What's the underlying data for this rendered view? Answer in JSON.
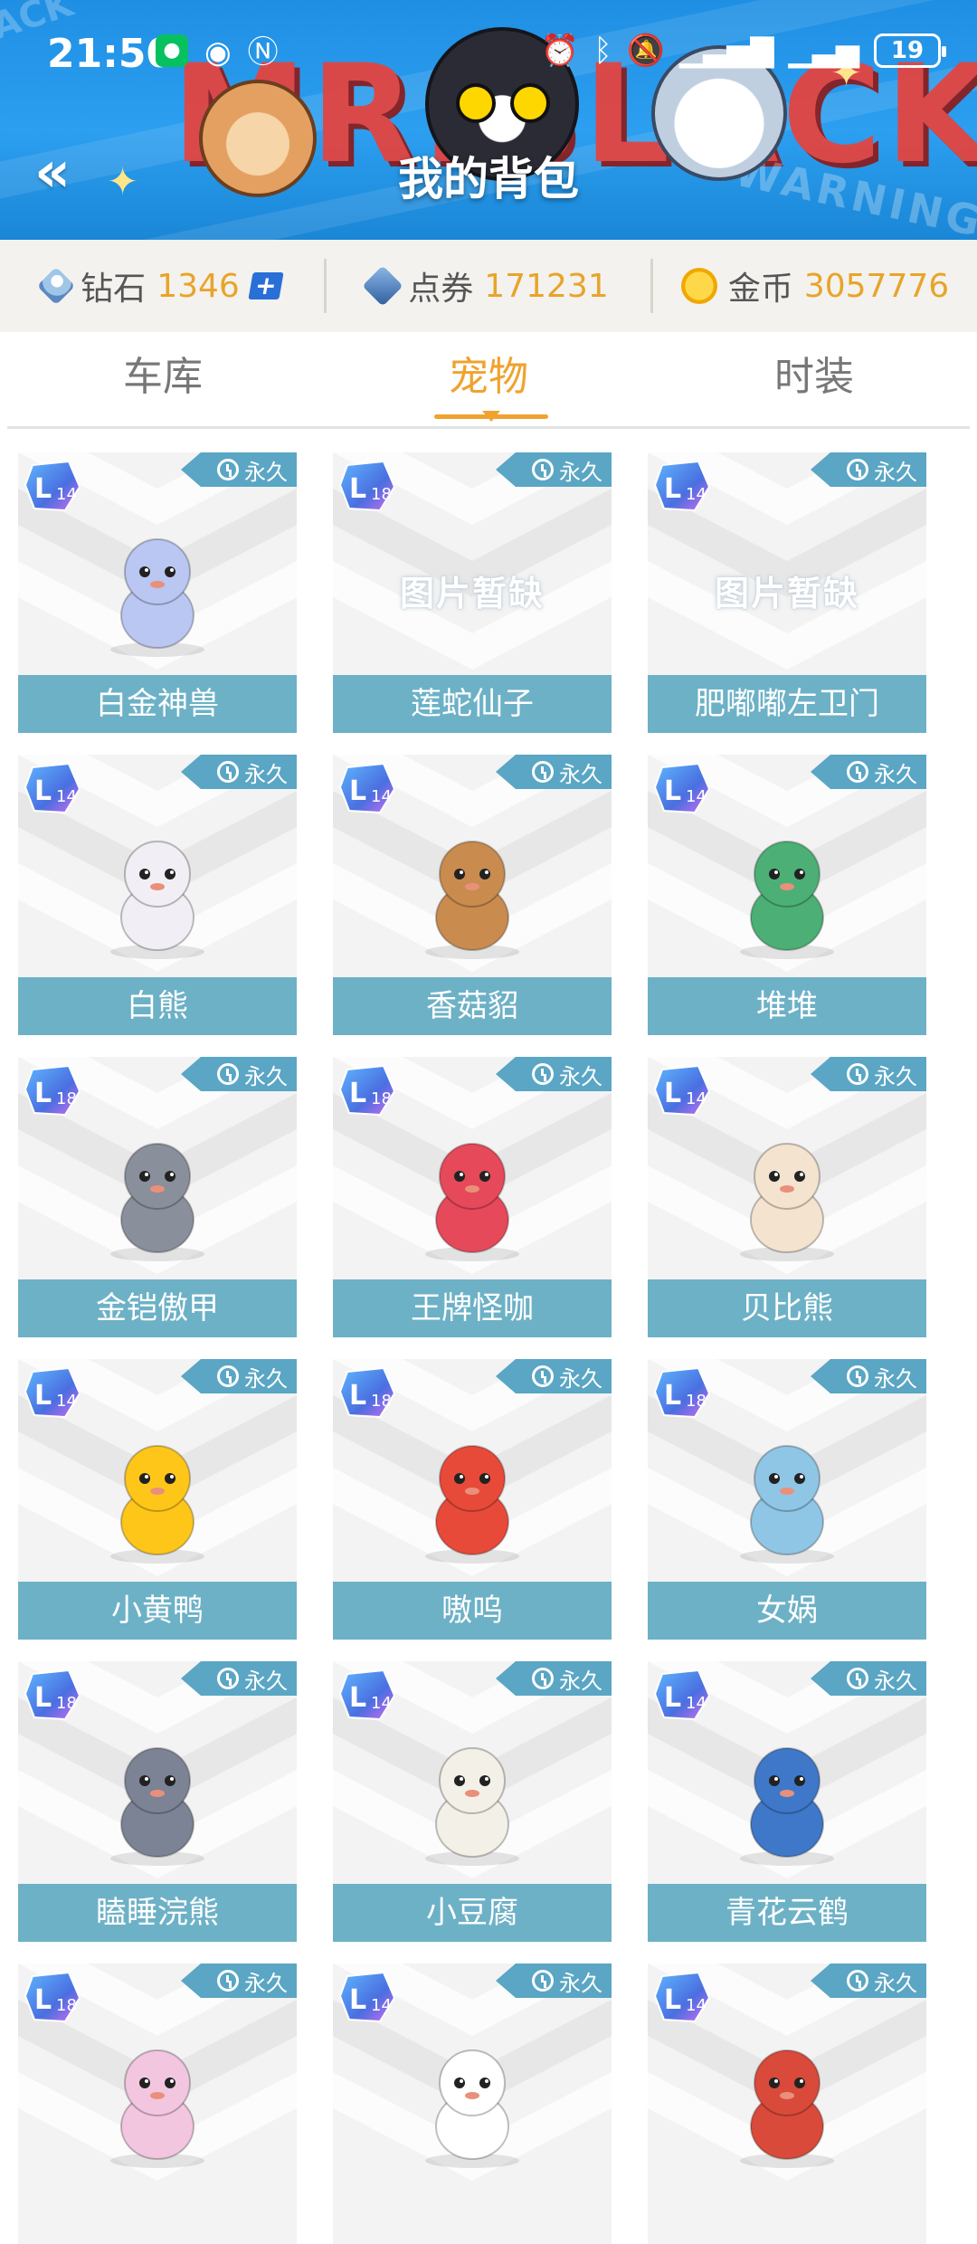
{
  "status_bar": {
    "time": "21:50",
    "battery": "19"
  },
  "header": {
    "title": "我的背包",
    "back_icon": "double-chevron-left-icon",
    "banner_text": "MR.BLACK",
    "banner_watermark": "WARNING"
  },
  "currencies": [
    {
      "key": "diamond",
      "label": "钻石",
      "value": "1346",
      "icon": "diamond-icon",
      "has_plus": true
    },
    {
      "key": "coupon",
      "label": "点券",
      "value": "171231",
      "icon": "coupon-icon",
      "has_plus": false
    },
    {
      "key": "coin",
      "label": "金币",
      "value": "3057776",
      "icon": "coin-icon",
      "has_plus": false
    }
  ],
  "tabs": [
    {
      "label": "车库",
      "active": false
    },
    {
      "label": "宠物",
      "active": true
    },
    {
      "label": "时装",
      "active": false
    }
  ],
  "colors": {
    "accent": "#f0a22e",
    "name_bar": "#6db1c6",
    "badge": "#5aa6c4",
    "header": "#2c9ff0"
  },
  "pets": [
    {
      "name": "白金神兽",
      "duration": "永久",
      "level": "14",
      "image": true,
      "pet_color": "#b9c7f2"
    },
    {
      "name": "莲蛇仙子",
      "duration": "永久",
      "level": "18",
      "image": false,
      "placeholder": "图片暂缺"
    },
    {
      "name": "肥嘟嘟左卫门",
      "duration": "永久",
      "level": "14",
      "image": false,
      "placeholder": "图片暂缺"
    },
    {
      "name": "白熊",
      "duration": "永久",
      "level": "14",
      "image": true,
      "pet_color": "#f2eef5"
    },
    {
      "name": "香菇貂",
      "duration": "永久",
      "level": "14",
      "image": true,
      "pet_color": "#c98b4e"
    },
    {
      "name": "堆堆",
      "duration": "永久",
      "level": "14",
      "image": true,
      "pet_color": "#4caf76"
    },
    {
      "name": "金铠傲甲",
      "duration": "永久",
      "level": "18",
      "image": true,
      "pet_color": "#8a8f9c"
    },
    {
      "name": "王牌怪咖",
      "duration": "永久",
      "level": "18",
      "image": true,
      "pet_color": "#e5495a"
    },
    {
      "name": "贝比熊",
      "duration": "永久",
      "level": "14",
      "image": true,
      "pet_color": "#f4e3cf"
    },
    {
      "name": "小黄鸭",
      "duration": "永久",
      "level": "14",
      "image": true,
      "pet_color": "#ffc61a"
    },
    {
      "name": "嗷呜",
      "duration": "永久",
      "level": "18",
      "image": true,
      "pet_color": "#e84a3a"
    },
    {
      "name": "女娲",
      "duration": "永久",
      "level": "18",
      "image": true,
      "pet_color": "#8fc6e6"
    },
    {
      "name": "瞌睡浣熊",
      "duration": "永久",
      "level": "18",
      "image": true,
      "pet_color": "#7c8395"
    },
    {
      "name": "小豆腐",
      "duration": "永久",
      "level": "14",
      "image": true,
      "pet_color": "#f3f0e8"
    },
    {
      "name": "青花云鹤",
      "duration": "永久",
      "level": "14",
      "image": true,
      "pet_color": "#3f78c9"
    },
    {
      "name": "",
      "duration": "永久",
      "level": "18",
      "image": true,
      "pet_color": "#f3c6e0"
    },
    {
      "name": "",
      "duration": "永久",
      "level": "14",
      "image": true,
      "pet_color": "#ffffff"
    },
    {
      "name": "",
      "duration": "永久",
      "level": "14",
      "image": true,
      "pet_color": "#d94a3a"
    }
  ]
}
